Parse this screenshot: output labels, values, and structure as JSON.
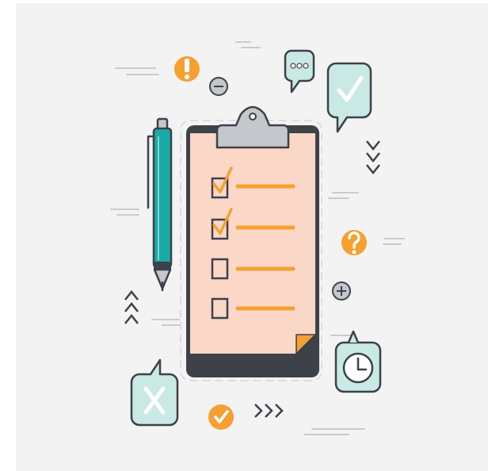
{
  "illustration": {
    "subject": "checklist-clipboard",
    "colors": {
      "background": "#f3f3f3",
      "outline": "#3d4148",
      "orange": "#f5a030",
      "paper": "#fbd7c7",
      "teal": "#19aaa6",
      "pale_teal": "#c9e9e5",
      "gray": "#c4c7cc",
      "line_gray": "#c8cbd0",
      "white": "#ffffff"
    },
    "checklist": {
      "items": [
        {
          "checked": true
        },
        {
          "checked": true
        },
        {
          "checked": false
        },
        {
          "checked": false
        }
      ]
    },
    "icons": [
      "exclamation-icon",
      "minus-icon",
      "chat-bubble-icon",
      "check-bubble-icon",
      "chevrons-down-icon",
      "question-icon",
      "plus-icon",
      "alarm-clock-icon",
      "x-bubble-icon",
      "check-circle-icon",
      "chevrons-right-icon",
      "chevrons-up-icon",
      "pen-icon",
      "clipboard-icon"
    ]
  }
}
